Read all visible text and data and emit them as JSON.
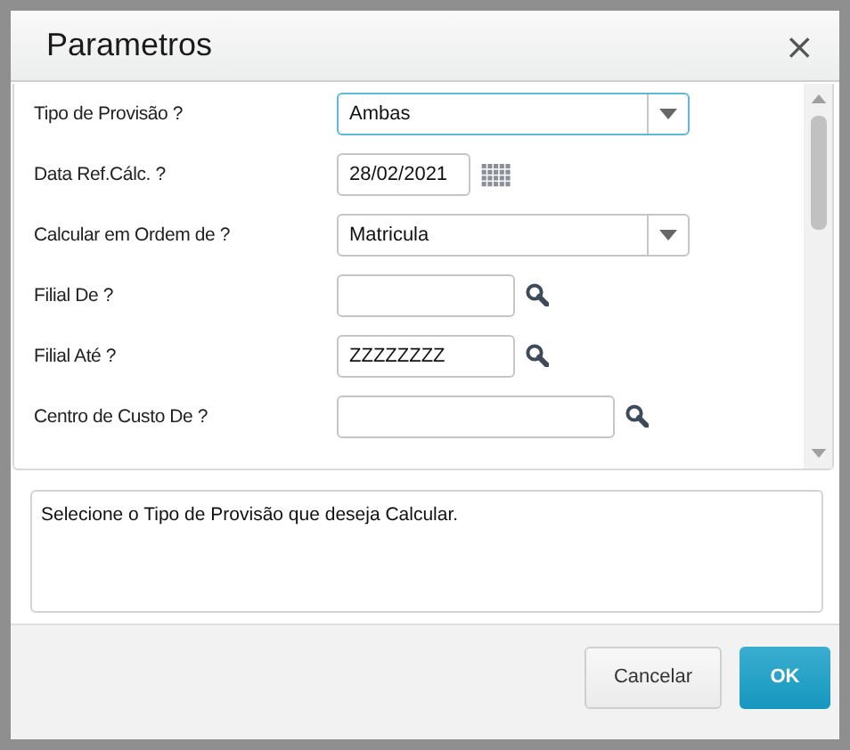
{
  "window": {
    "title": "Parametros",
    "close": "×"
  },
  "parameters": [
    {
      "label": "Tipo de Provisão ?",
      "kind": "select",
      "value": "Ambas",
      "focused": true
    },
    {
      "label": "Data Ref.Cálc. ?",
      "kind": "date",
      "value": "28/02/2021",
      "focused": false
    },
    {
      "label": "Calcular em Ordem de ?",
      "kind": "select",
      "value": "Matricula",
      "focused": false
    },
    {
      "label": "Filial De ?",
      "kind": "lookup",
      "focused": false
    },
    {
      "label": "Filial Até ?",
      "kind": "lookup",
      "value": "ZZZZZZZZ",
      "focused": false
    },
    {
      "label": "Centro de Custo De ?",
      "kind": "lookup",
      "focused": false
    }
  ],
  "help_text": "Selecione o Tipo de Provisão que deseja Calcular.",
  "buttons": [
    {
      "label": "Cancelar",
      "kind": "secondary"
    },
    {
      "label": "OK",
      "kind": "primary"
    }
  ]
}
